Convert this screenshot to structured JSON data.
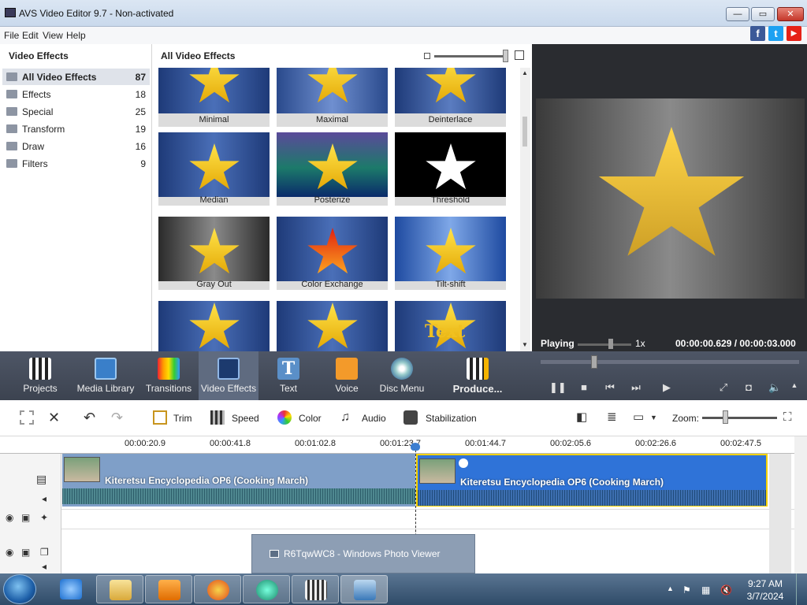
{
  "window": {
    "title": "AVS Video Editor 9.7 - Non-activated",
    "min": "—",
    "max": "▭",
    "close": "✕"
  },
  "menu": [
    "File",
    "Edit",
    "View",
    "Help"
  ],
  "social": [
    "f",
    "t",
    "▶"
  ],
  "left_panel": {
    "header": "Video Effects",
    "categories": [
      {
        "label": "All Video Effects",
        "count": "87"
      },
      {
        "label": "Effects",
        "count": "18"
      },
      {
        "label": "Special",
        "count": "25"
      },
      {
        "label": "Transform",
        "count": "19"
      },
      {
        "label": "Draw",
        "count": "16"
      },
      {
        "label": "Filters",
        "count": "9"
      }
    ]
  },
  "gallery": {
    "header": "All Video Effects",
    "tiles": [
      "Minimal",
      "Maximal",
      "Deinterlace",
      "Median",
      "Posterize",
      "Threshold",
      "Gray Out",
      "Color Exchange",
      "Tilt-shift",
      "",
      "",
      "Text"
    ]
  },
  "preview": {
    "status": "Playing",
    "speed": "1x",
    "time": "00:00:00.629  /  00:00:03.000"
  },
  "main_toolbar": [
    "Projects",
    "Media Library",
    "Transitions",
    "Video Effects",
    "Text",
    "Voice",
    "Disc Menu",
    "Produce..."
  ],
  "edit_toolbar": {
    "trim": "Trim",
    "speed": "Speed",
    "color": "Color",
    "audio": "Audio",
    "stabilization": "Stabilization",
    "zoom": "Zoom:"
  },
  "timeline": {
    "ticks": [
      "00:00:20.9",
      "00:00:41.8",
      "00:01:02.8",
      "00:01:23.7",
      "00:01:44.7",
      "00:02:05.6",
      "00:02:26.6",
      "00:02:47.5"
    ],
    "clips": [
      "Kiteretsu Encyclopedia OP6 (Cooking March)",
      "Kiteretsu Encyclopedia OP6 (Cooking March)"
    ]
  },
  "popup": {
    "text": "R6TqwWC8 - Windows Photo Viewer"
  },
  "taskbar": {
    "time": "9:27 AM",
    "date": "3/7/2024"
  }
}
